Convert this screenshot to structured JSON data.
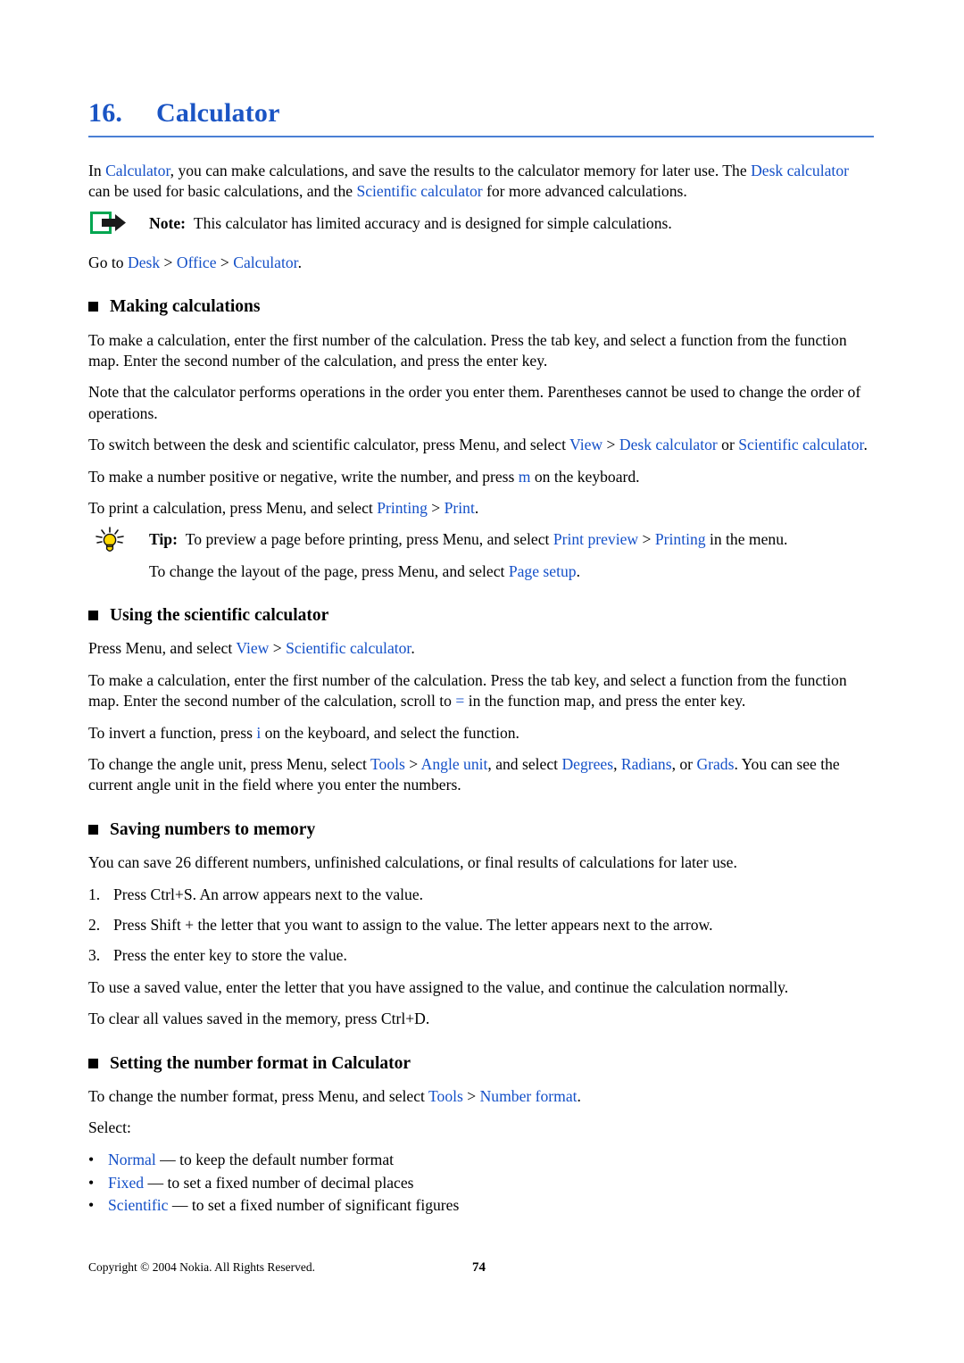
{
  "chapter": {
    "number": "16.",
    "name": "Calculator"
  },
  "intro": {
    "p1_a": "In ",
    "p1_link1": "Calculator",
    "p1_b": ", you can make calculations, and save the results to the calculator memory for later use. The ",
    "p1_link2": "Desk calculator",
    "p1_c": " can be used for basic calculations, and the ",
    "p1_link3": "Scientific calculator",
    "p1_d": " for more advanced calculations."
  },
  "note": {
    "icon": "note-arrow-icon",
    "label": "Note:",
    "text": "This calculator has limited accuracy and is designed for simple calculations."
  },
  "goto": {
    "prefix": "Go to ",
    "item1": "Desk",
    "sep1": " > ",
    "item2": "Office",
    "sep2": " > ",
    "item3": "Calculator",
    "suffix": "."
  },
  "sections": [
    {
      "heading": "Making calculations",
      "p1": "To make a calculation, enter the first number of the calculation. Press the tab key, and select a function from the function map. Enter the second number of the calculation, and press the enter key.",
      "p2": "Note that the calculator performs operations in the order you enter them. Parentheses cannot be used to change the order of operations.",
      "p3_a": "To switch between the desk and scientific calculator, press Menu, and select ",
      "p3_link1": "View",
      "p3_sep1": " > ",
      "p3_link2": "Desk calculator",
      "p3_b": " or ",
      "p3_link3": "Scientific calculator",
      "p3_c": ".",
      "p4_a": "To make a number positive or negative, write the number, and press ",
      "p4_key": "m",
      "p4_b": " on the keyboard.",
      "p5_a": "To print a calculation, press Menu, and select ",
      "p5_link1": "Printing",
      "p5_sep1": " > ",
      "p5_link2": "Print",
      "p5_b": "."
    }
  ],
  "tip": {
    "icon": "lightbulb-icon",
    "label": "Tip:",
    "t1_a": "To preview a page before printing, press Menu, and select ",
    "t1_link1": "Print preview",
    "t1_sep1": " > ",
    "t1_link2": "Printing",
    "t1_b": " in the menu.",
    "t2_a": "To change the layout of the page, press Menu, and select ",
    "t2_link1": "Page setup",
    "t2_b": "."
  },
  "scientific": {
    "heading": "Using the scientific calculator",
    "p1_a": "Press Menu, and select ",
    "p1_link1": "View",
    "p1_sep1": " > ",
    "p1_link2": "Scientific calculator",
    "p1_b": ".",
    "p2_a": "To make a calculation, enter the first number of the calculation. Press the tab key, and select a function from the function map. Enter the second number of the calculation, scroll to ",
    "p2_key": "=",
    "p2_b": " in the function map, and press the enter key.",
    "p3_a": "To invert a function, press ",
    "p3_key": "i",
    "p3_b": " on the keyboard, and select the function.",
    "p4_a": "To change the angle unit, press Menu, select ",
    "p4_link1": "Tools",
    "p4_sep1": " > ",
    "p4_link2": "Angle unit",
    "p4_b": ", and select ",
    "p4_link3": "Degrees",
    "p4_c": ", ",
    "p4_link4": "Radians",
    "p4_d": ", or ",
    "p4_link5": "Grads",
    "p4_e": ". You can see the current angle unit in the field where you enter the numbers."
  },
  "memory": {
    "heading": "Saving numbers to memory",
    "intro": "You can save 26 different numbers, unfinished calculations, or final results of calculations for later use.",
    "steps": [
      {
        "num": "1.",
        "text": "Press Ctrl+S. An arrow appears next to the value."
      },
      {
        "num": "2.",
        "text": "Press Shift + the letter that you want to assign to the value. The letter appears next to the arrow."
      },
      {
        "num": "3.",
        "text": "Press the enter key to store the value."
      }
    ],
    "after1": "To use a saved value, enter the letter that you have assigned to the value, and continue the calculation normally.",
    "after2": "To clear all values saved in the memory, press Ctrl+D."
  },
  "numberformat": {
    "heading": "Setting the number format in Calculator",
    "p1_a": "To change the number format, press Menu, and select ",
    "p1_link1": "Tools",
    "p1_sep1": " > ",
    "p1_link2": "Number format",
    "p1_b": ".",
    "select_label": "Select:",
    "options": [
      {
        "bullet": "•",
        "term": "Normal",
        "desc": " — to keep the default number format"
      },
      {
        "bullet": "•",
        "term": "Fixed",
        "desc": " — to set a fixed number of decimal places"
      },
      {
        "bullet": "•",
        "term": "Scientific",
        "desc": " — to set a fixed number of significant figures"
      }
    ]
  },
  "footer": {
    "copyright": "Copyright © 2004 Nokia. All Rights Reserved.",
    "page": "74"
  },
  "colors": {
    "link_blue": "#1450c8",
    "title_blue": "#1b55c4",
    "rule_blue": "#4a7fd4",
    "note_green": "#00a650",
    "tip_yellow": "#ffd900"
  }
}
